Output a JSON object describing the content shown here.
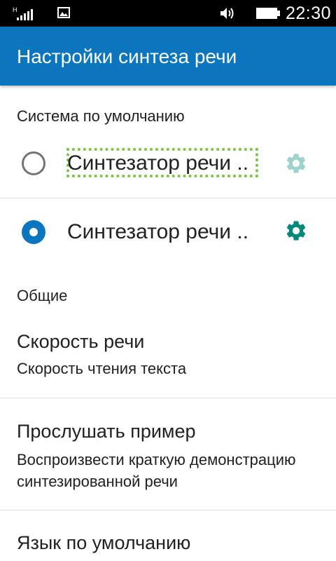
{
  "status_bar": {
    "network_type": "H",
    "time": "22:30",
    "icons": [
      "signal-icon",
      "image-notification-icon",
      "volume-icon",
      "battery-icon"
    ]
  },
  "app_bar": {
    "title": "Настройки синтеза речи"
  },
  "default_engine_section": {
    "header": "Система по умолчанию",
    "engines": [
      {
        "label": "Синтезатор речи ..",
        "selected": false,
        "settings_icon": "gear-icon",
        "settings_enabled": false
      },
      {
        "label": "Синтезатор речи ..",
        "selected": true,
        "settings_icon": "gear-icon",
        "settings_enabled": true
      }
    ]
  },
  "general_section": {
    "header": "Общие",
    "items": [
      {
        "title": "Скорость речи",
        "summary": "Скорость чтения текста"
      },
      {
        "title": "Прослушать пример",
        "summary": "Воспроизвести краткую демонстрацию синтезированной речи"
      },
      {
        "title": "Язык по умолчанию",
        "summary": ""
      }
    ]
  },
  "colors": {
    "accent": "#0b75bd",
    "gear_active": "#00897b",
    "gear_disabled": "#9fd2cc",
    "focus_outline": "#7cc242"
  }
}
